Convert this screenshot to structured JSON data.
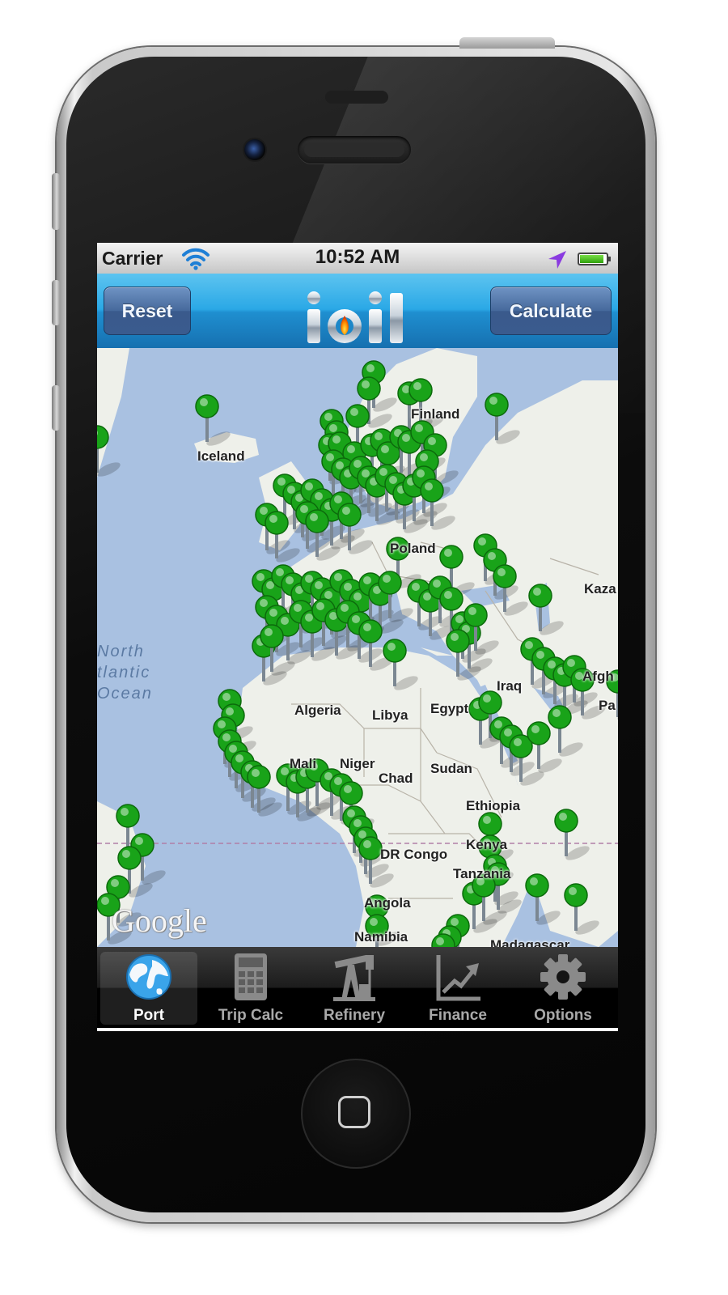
{
  "status_bar": {
    "carrier": "Carrier",
    "time": "10:52 AM",
    "battery_level": 0.9
  },
  "nav_bar": {
    "left_button": "Reset",
    "right_button": "Calculate",
    "logo_text": "ioil"
  },
  "map": {
    "place_labels": [
      "Iceland",
      "Finland",
      "Poland",
      "Kaza",
      "North",
      "tlantic",
      "Ocean",
      "Algeria",
      "Libya",
      "Egypt",
      "Iraq",
      "Afgh",
      "Pa",
      "Mali",
      "Niger",
      "Chad",
      "Sudan",
      "Ethiopia",
      "DR Congo",
      "Kenya",
      "Tanzania",
      "Angola",
      "Namibia",
      "Madagascar"
    ],
    "attribution": "Google",
    "marker_color": "#19a319"
  },
  "tab_bar": {
    "tabs": [
      {
        "label": "Port",
        "icon": "globe-icon",
        "active": true
      },
      {
        "label": "Trip Calc",
        "icon": "calculator-icon",
        "active": false
      },
      {
        "label": "Refinery",
        "icon": "oil-pump-icon",
        "active": false
      },
      {
        "label": "Finance",
        "icon": "chart-up-icon",
        "active": false
      },
      {
        "label": "Options",
        "icon": "gear-icon",
        "active": false
      }
    ]
  }
}
